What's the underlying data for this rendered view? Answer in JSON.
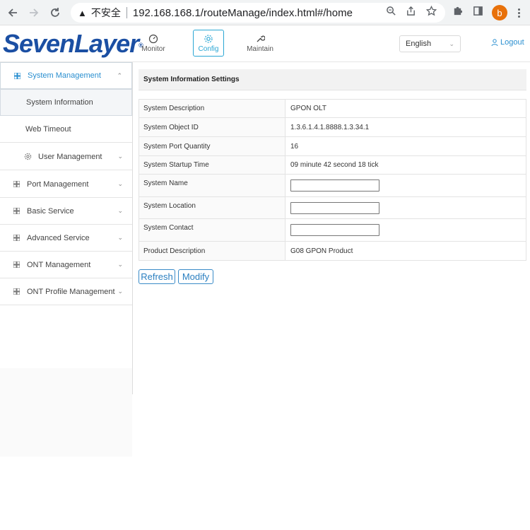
{
  "browser": {
    "security_label": "不安全",
    "url": "192.168.168.1/routeManage/index.html#/home",
    "profile_initial": "b"
  },
  "header": {
    "logo_text": "SevenLayer",
    "logo_mark": "®",
    "nav": [
      {
        "label": "Monitor",
        "icon": "gauge-icon"
      },
      {
        "label": "Config",
        "icon": "gear-icon"
      },
      {
        "label": "Maintain",
        "icon": "wrench-icon"
      }
    ],
    "language": "English",
    "logout_label": "Logout",
    "accent_color": "#2aa6d4",
    "logo_color": "#1b4fa3"
  },
  "sidebar": {
    "items": [
      {
        "label": "System Management",
        "expanded": true
      },
      {
        "label": "System Information"
      },
      {
        "label": "Web Timeout"
      },
      {
        "label": "User Management"
      },
      {
        "label": "Port Management"
      },
      {
        "label": "Basic Service"
      },
      {
        "label": "Advanced Service"
      },
      {
        "label": "ONT Management"
      },
      {
        "label": "ONT Profile Management"
      }
    ]
  },
  "main": {
    "panel_title": "System Information Settings",
    "rows": [
      {
        "label": "System Description",
        "value": "GPON OLT"
      },
      {
        "label": "System Object ID",
        "value": "1.3.6.1.4.1.8888.1.3.34.1"
      },
      {
        "label": "System Port Quantity",
        "value": "16"
      },
      {
        "label": "System Startup Time",
        "value": "09 minute 42 second 18 tick"
      },
      {
        "label": "System Name",
        "value": ""
      },
      {
        "label": "System Location",
        "value": ""
      },
      {
        "label": "System Contact",
        "value": ""
      },
      {
        "label": "Product Description",
        "value": "G08 GPON Product"
      }
    ],
    "refresh_label": "Refresh",
    "modify_label": "Modify"
  }
}
